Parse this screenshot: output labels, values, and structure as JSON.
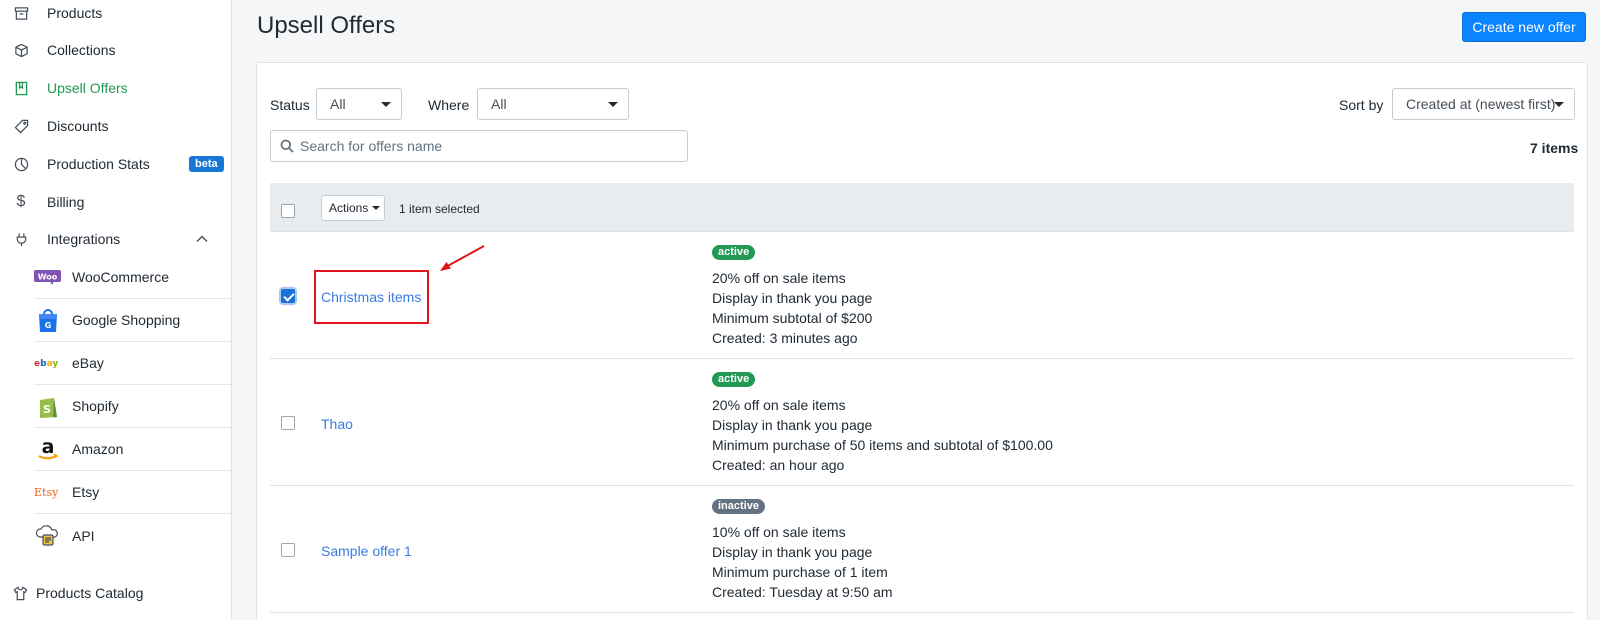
{
  "sidebar": {
    "items": [
      {
        "label": "Products",
        "icon": "archive-box-icon"
      },
      {
        "label": "Collections",
        "icon": "cube-icon"
      },
      {
        "label": "Upsell Offers",
        "icon": "book-icon",
        "active": true
      },
      {
        "label": "Discounts",
        "icon": "tag-icon"
      },
      {
        "label": "Production Stats",
        "icon": "pie-chart-icon",
        "badge": "beta"
      },
      {
        "label": "Billing",
        "icon": "dollar-icon"
      },
      {
        "label": "Integrations",
        "icon": "plug-icon",
        "expanded": true
      }
    ],
    "integrations": [
      {
        "label": "WooCommerce",
        "icon": "woocommerce-logo-icon"
      },
      {
        "label": "Google Shopping",
        "icon": "google-shopping-bag-icon"
      },
      {
        "label": "eBay",
        "icon": "ebay-logo-icon"
      },
      {
        "label": "Shopify",
        "icon": "shopify-bag-icon"
      },
      {
        "label": "Amazon",
        "icon": "amazon-logo-icon"
      },
      {
        "label": "Etsy",
        "icon": "etsy-logo-icon"
      },
      {
        "label": "API",
        "icon": "api-cloud-icon"
      }
    ],
    "catalog": {
      "label": "Products Catalog",
      "icon": "shirt-icon"
    }
  },
  "header": {
    "title": "Upsell Offers",
    "create_button": "Create new offer"
  },
  "filters": {
    "status_label": "Status",
    "status_value": "All",
    "where_label": "Where",
    "where_value": "All",
    "sort_label": "Sort by",
    "sort_value": "Created at (newest first)",
    "search_placeholder": "Search for offers name",
    "items_count": "7 items"
  },
  "bulk": {
    "actions_label": "Actions",
    "selected_text": "1 item selected"
  },
  "colors": {
    "active_green": "#229954",
    "primary_blue": "#0a84ff",
    "link_blue": "#3a7be0",
    "inactive_gray": "#637381",
    "highlight_red": "#e0141b"
  },
  "offers": [
    {
      "name": "Christmas items",
      "checked": true,
      "status": "active",
      "lines": [
        "20% off on sale items",
        "Display in thank you page",
        "Minimum subtotal of $200",
        "Created: 3 minutes ago"
      ]
    },
    {
      "name": "Thao",
      "checked": false,
      "status": "active",
      "lines": [
        "20% off on sale items",
        "Display in thank you page",
        "Minimum purchase of 50 items and subtotal of $100.00",
        "Created: an hour ago"
      ]
    },
    {
      "name": "Sample offer 1",
      "checked": false,
      "status": "inactive",
      "lines": [
        "10% off on sale items",
        "Display in thank you page",
        "Minimum purchase of 1 item",
        "Created: Tuesday at 9:50 am"
      ]
    }
  ]
}
